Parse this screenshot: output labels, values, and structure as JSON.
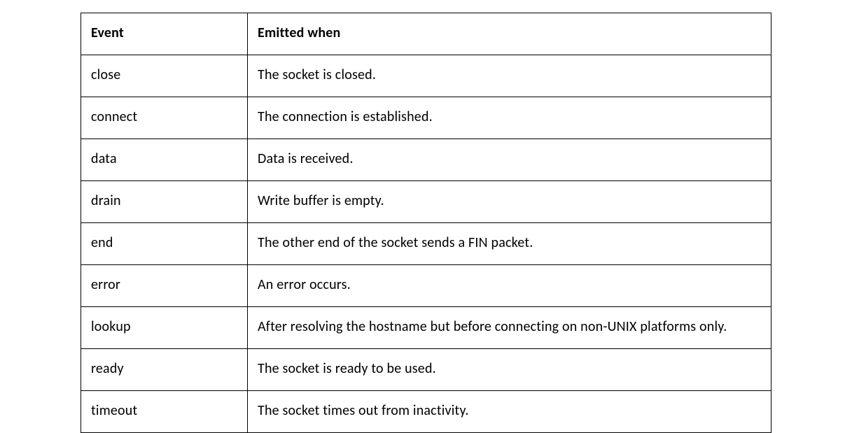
{
  "table": {
    "headers": {
      "event": "Event",
      "emitted_when": "Emitted when"
    },
    "rows": [
      {
        "event": "close",
        "desc": "The socket is closed."
      },
      {
        "event": "connect",
        "desc": "The connection is established."
      },
      {
        "event": "data",
        "desc": "Data is received."
      },
      {
        "event": "drain",
        "desc": "Write buffer is empty."
      },
      {
        "event": "end",
        "desc": "The other end of the socket sends a FIN packet."
      },
      {
        "event": "error",
        "desc": "An error occurs."
      },
      {
        "event": "lookup",
        "desc": "After resolving the hostname but before connecting on non-UNIX platforms only."
      },
      {
        "event": "ready",
        "desc": "The socket is ready to be used."
      },
      {
        "event": "timeout",
        "desc": "The socket times out from inactivity."
      }
    ]
  }
}
